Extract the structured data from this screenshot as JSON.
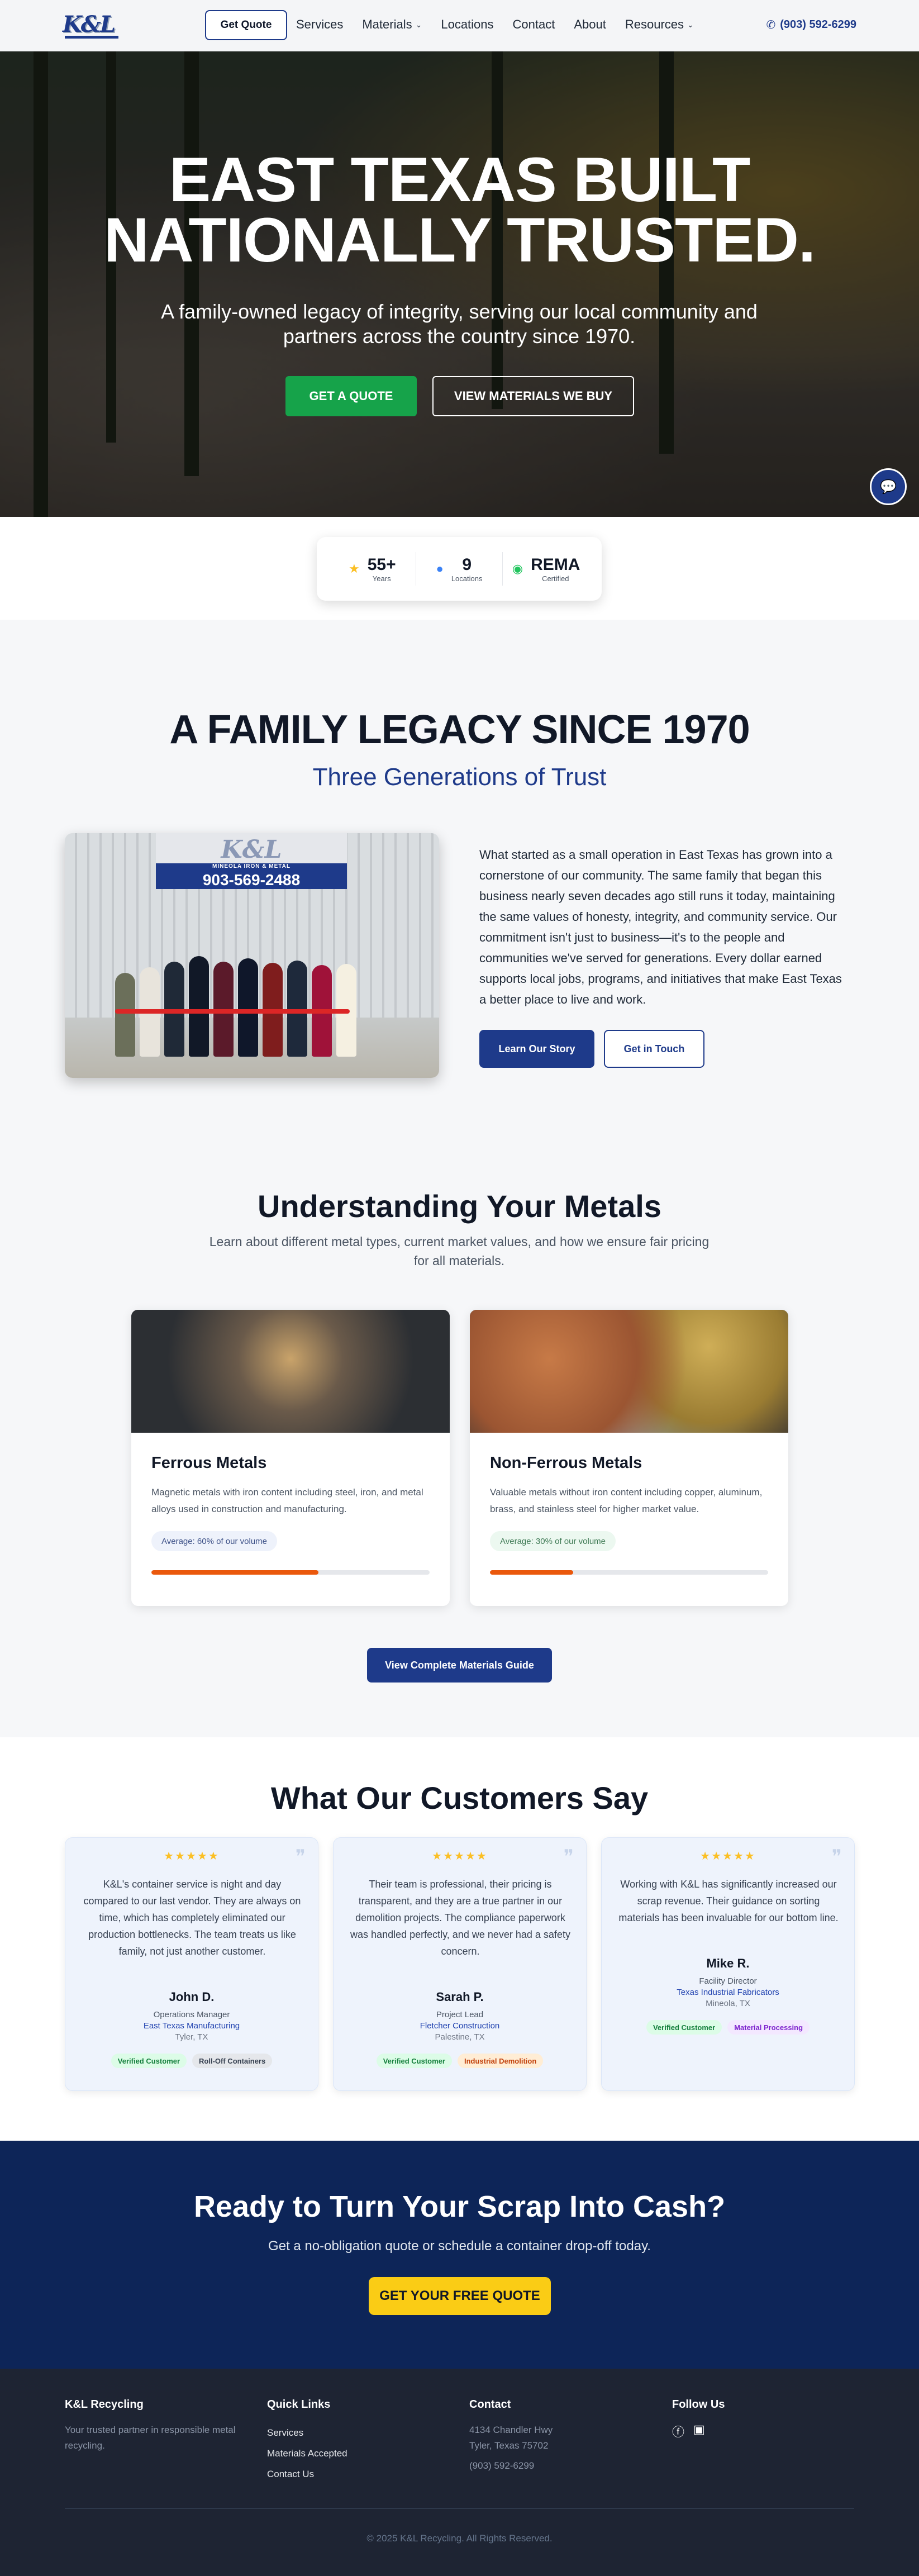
{
  "nav": {
    "logo_text": "K&L",
    "quote_button": "Get Quote",
    "links": [
      "Services",
      "Materials",
      "Locations",
      "Contact",
      "About",
      "Resources"
    ],
    "phone": "(903) 592-6299"
  },
  "hero": {
    "title_line1": "EAST TEXAS BUILT",
    "title_line2": "NATIONALLY TRUSTED.",
    "subtitle": "A family-owned legacy of integrity, serving our local community and partners across the country since 1970.",
    "primary_button": "GET A QUOTE",
    "secondary_button": "VIEW MATERIALS WE BUY"
  },
  "stats": [
    {
      "icon": "star-icon",
      "value": "55+",
      "label": "Years"
    },
    {
      "icon": "location-pin-icon",
      "value": "9",
      "label": "Locations"
    },
    {
      "icon": "check-circle-icon",
      "value": "REMA",
      "label": "Certified"
    }
  ],
  "legacy": {
    "title": "A FAMILY LEGACY SINCE 1970",
    "subtitle": "Three Generations of Trust",
    "photo_sign_logo": "K&L",
    "photo_sign_name": "MINEOLA IRON & METAL",
    "photo_sign_phone": "903-569-2488",
    "body": "What started as a small operation in East Texas has grown into a cornerstone of our community. The same family that began this business nearly seven decades ago still runs it today, maintaining the same values of honesty, integrity, and community service. Our commitment isn't just to business—it's to the people and communities we've served for generations. Every dollar earned supports local jobs, programs, and initiatives that make East Texas a better place to live and work.",
    "primary_button": "Learn Our Story",
    "secondary_button": "Get in Touch"
  },
  "metals": {
    "title": "Understanding Your Metals",
    "subtitle": "Learn about different metal types, current market values, and how we ensure fair pricing for all materials.",
    "cards": [
      {
        "title": "Ferrous Metals",
        "description": "Magnetic metals with iron content including steel, iron, and metal alloys used in construction and manufacturing.",
        "badge": "Average: 60% of our volume",
        "share": 0.6,
        "badge_bg": "#eef2fb",
        "badge_color": "#3b4f86"
      },
      {
        "title": "Non-Ferrous Metals",
        "description": "Valuable metals without iron content including copper, aluminum, brass, and stainless steel for higher market value.",
        "badge": "Average: 30% of our volume",
        "share": 0.3,
        "badge_bg": "#ecf8f0",
        "badge_color": "#3f7a55"
      }
    ],
    "guide_button": "View Complete Materials Guide"
  },
  "testimonials": {
    "title": "What Our Customers Say",
    "items": [
      {
        "stars": "★★★★★",
        "quote": "K&L's container service is night and day compared to our last vendor. They are always on time, which has completely eliminated our production bottlenecks. The team treats us like family, not just another customer.",
        "name": "John D.",
        "role": "Operations Manager",
        "company": "East Texas Manufacturing",
        "location": "Tyler, TX",
        "badges": [
          {
            "text": "Verified Customer",
            "bg": "#dcfce7",
            "color": "#15803d"
          },
          {
            "text": "Roll-Off Containers",
            "bg": "#e5e7eb",
            "color": "#374151"
          }
        ]
      },
      {
        "stars": "★★★★★",
        "quote": "Their team is professional, their pricing is transparent, and they are a true partner in our demolition projects. The compliance paperwork was handled perfectly, and we never had a safety concern.",
        "name": "Sarah P.",
        "role": "Project Lead",
        "company": "Fletcher Construction",
        "location": "Palestine, TX",
        "badges": [
          {
            "text": "Verified Customer",
            "bg": "#dcfce7",
            "color": "#15803d"
          },
          {
            "text": "Industrial Demolition",
            "bg": "#ffedd5",
            "color": "#c2410c"
          }
        ]
      },
      {
        "stars": "★★★★★",
        "quote": "Working with K&L has significantly increased our scrap revenue. Their guidance on sorting materials has been invaluable for our bottom line.",
        "name": "Mike R.",
        "role": "Facility Director",
        "company": "Texas Industrial Fabricators",
        "location": "Mineola, TX",
        "badges": [
          {
            "text": "Verified Customer",
            "bg": "#dcfce7",
            "color": "#15803d"
          },
          {
            "text": "Material Processing",
            "bg": "#f3e8ff",
            "color": "#7e22ce"
          }
        ]
      }
    ]
  },
  "cta": {
    "title": "Ready to Turn Your Scrap Into Cash?",
    "subtitle": "Get a no-obligation quote or schedule a container drop-off today.",
    "button": "GET YOUR FREE QUOTE"
  },
  "footer": {
    "brand_title": "K&L Recycling",
    "brand_text": "Your trusted partner in responsible metal recycling.",
    "quick_links_title": "Quick Links",
    "quick_links": [
      "Services",
      "Materials Accepted",
      "Contact Us"
    ],
    "contact_title": "Contact",
    "address_line1": "4134 Chandler Hwy",
    "address_line2": "Tyler, Texas 75702",
    "phone": "(903) 592-6299",
    "follow_title": "Follow Us",
    "social": [
      "facebook-icon",
      "linkedin-icon"
    ],
    "copyright": "© 2025 K&L Recycling. All Rights Reserved."
  }
}
